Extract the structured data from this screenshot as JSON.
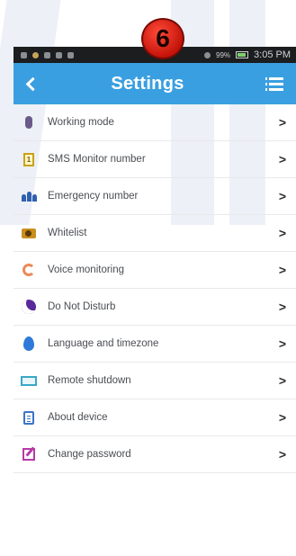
{
  "status_bar": {
    "time": "3:05 PM",
    "battery_text": "99%"
  },
  "step_badge": {
    "number": "6",
    "color": "#d61a0c"
  },
  "app_bar": {
    "title": "Settings",
    "back_icon": "back-arrow-icon",
    "menu_icon": "list-menu-icon",
    "color": "#3a9fe0"
  },
  "settings": {
    "items": [
      {
        "label": "Working mode",
        "icon": "phone-icon"
      },
      {
        "label": "SMS Monitor number",
        "icon": "sms-icon"
      },
      {
        "label": "Emergency number",
        "icon": "people-icon"
      },
      {
        "label": "Whitelist",
        "icon": "contact-card-icon"
      },
      {
        "label": "Voice monitoring",
        "icon": "headset-icon"
      },
      {
        "label": "Do Not Disturb",
        "icon": "moon-icon"
      },
      {
        "label": "Language and timezone",
        "icon": "globe-icon"
      },
      {
        "label": "Remote shutdown",
        "icon": "monitor-icon"
      },
      {
        "label": "About device",
        "icon": "document-icon"
      },
      {
        "label": "Change password",
        "icon": "edit-icon"
      }
    ],
    "chevron": ">"
  }
}
